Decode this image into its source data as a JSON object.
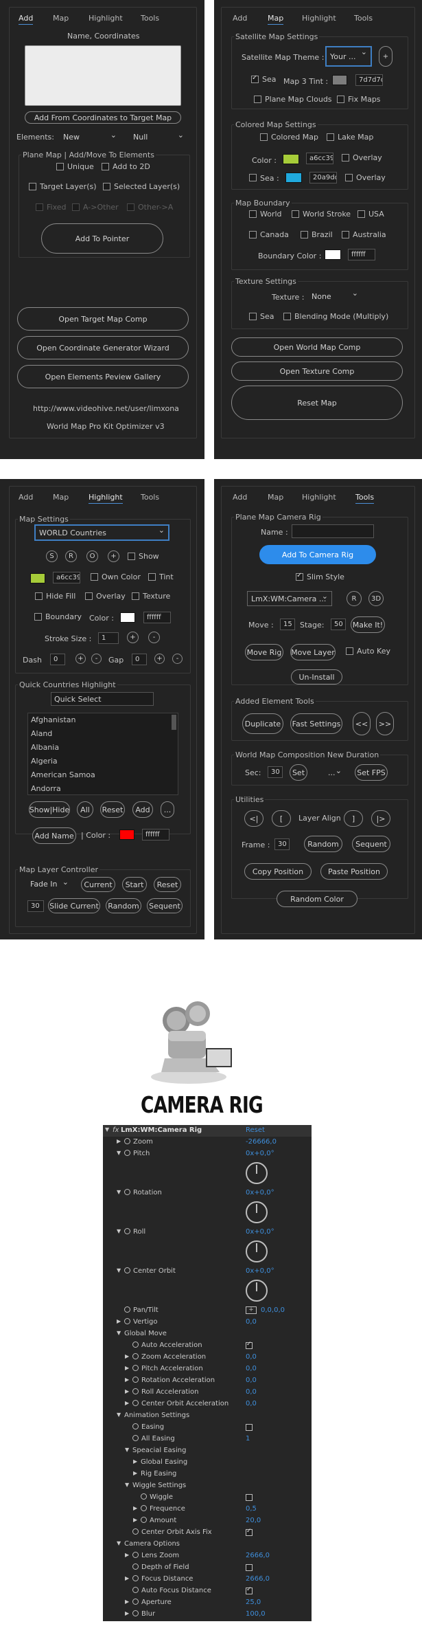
{
  "panel1": {
    "tabs": [
      "Add",
      "Map",
      "Highlight",
      "Tools"
    ],
    "coords_label": "Name, Coordinates",
    "add_from_coords": "Add From Coordinates to Target Map",
    "elements_label": "Elements:",
    "elements_value": "New",
    "elements_value2": "Null",
    "plane_map_group": "Plane Map | Add/Move To Elements",
    "unique": "Unique",
    "add_to_2d": "Add to 2D",
    "target_layers": "Target Layer(s)",
    "selected_layers": "Selected Layer(s)",
    "fixed": "Fixed",
    "a_to_other": "A->Other",
    "other_to_a": "Other->A",
    "add_to_pointer": "Add To Pointer",
    "open_target_map": "Open Target Map Comp",
    "open_coord_gen": "Open Coordinate Generator Wizard",
    "open_elements": "Open Elements Peview Gallery",
    "url": "http://www.videohive.net/user/limxona",
    "version": "World Map Pro Kit Optimizer v3"
  },
  "panel2": {
    "tabs": [
      "Add",
      "Map",
      "Highlight",
      "Tools"
    ],
    "sat_group": "Satellite Map Settings",
    "sat_theme_label": "Satellite Map Theme :",
    "sat_theme_value": "Your ...",
    "plus": "+",
    "sea": "Sea",
    "map3_tint": "Map 3 Tint :",
    "map3_tint_hex": "7d7d7d",
    "plane_map_clouds": "Plane Map Clouds",
    "fix_maps": "Fix Maps",
    "colored_group": "Colored Map Settings",
    "colored_map": "Colored Map",
    "lake_map": "Lake Map",
    "color_label": "Color :",
    "color_hex": "a6cc39",
    "overlay": "Overlay",
    "sea_label": "Sea :",
    "sea_hex": "20a9dd",
    "overlay2": "Overlay",
    "boundary_group": "Map Boundary",
    "world": "World",
    "world_stroke": "World Stroke",
    "usa": "USA",
    "canada": "Canada",
    "brazil": "Brazil",
    "australia": "Australia",
    "boundary_color_label": "Boundary Color :",
    "boundary_hex": "ffffff",
    "texture_group": "Texture Settings",
    "texture_label": "Texture :",
    "texture_value": "None",
    "sea2": "Sea",
    "blending": "Blending Mode (Multiply)",
    "open_world": "Open World Map Comp",
    "open_texture": "Open Texture Comp",
    "reset_map": "Reset Map"
  },
  "panel3": {
    "tabs": [
      "Add",
      "Map",
      "Highlight",
      "Tools"
    ],
    "map_settings": "Map Settings",
    "world_countries": "WORLD Countries",
    "btn_s": "S",
    "btn_r": "R",
    "btn_o": "O",
    "btn_plus": "+",
    "show": "Show",
    "color_hex": "a6cc39",
    "own_color": "Own Color",
    "tint": "Tint",
    "hide_fill": "Hide Fill",
    "overlay": "Overlay",
    "texture": "Texture",
    "boundary": "Boundary",
    "color_label": "Color :",
    "boundary_hex": "ffffff",
    "stroke_size_label": "Stroke Size :",
    "stroke_size": "1",
    "dash_label": "Dash",
    "dash_value": "0",
    "gap_label": "Gap",
    "gap_value": "0",
    "quick_group": "Quick Countries Highlight",
    "quick_select": "Quick Select",
    "countries": [
      "Afghanistan",
      "Aland",
      "Albania",
      "Algeria",
      "American Samoa",
      "Andorra"
    ],
    "show_hide": "Show|Hide",
    "all": "All",
    "reset": "Reset",
    "add": "Add",
    "dots": "...",
    "add_name": "Add Name",
    "color2_label": "| Color :",
    "color2_hex": "ffffff",
    "layer_ctrl": "Map Layer Controller",
    "fade_in": "Fade In",
    "current": "Current",
    "start": "Start",
    "reset2": "Reset",
    "n30": "30",
    "slide_current": "Slide Current",
    "random": "Random",
    "sequent": "Sequent"
  },
  "panel4": {
    "tabs": [
      "Add",
      "Map",
      "Highlight",
      "Tools"
    ],
    "cam_group": "Plane Map Camera Rig",
    "name_label": "Name :",
    "add_cam": "Add To Camera Rig",
    "slim": "Slim Style",
    "cam_dd": "LmX:WM:Camera ...",
    "r": "R",
    "threeD": "3D",
    "move_label": "Move :",
    "move_value": "15",
    "stage_label": "Stage:",
    "stage_value": "50",
    "make_it": "Make It!",
    "move_rig": "Move Rig",
    "move_layer": "Move Layer",
    "auto_key": "Auto Key",
    "uninstall": "Un-Install",
    "added_group": "Added Element Tools",
    "duplicate": "Duplicate",
    "fast_settings": "Fast Settings",
    "prev": "<<",
    "next": ">>",
    "comp_group": "World Map Composition New Duration",
    "sec_label": "Sec:",
    "sec_value": "30",
    "set": "Set",
    "set_dd": "...",
    "set_fps": "Set FPS",
    "util_group": "Utilities",
    "al1": "<|",
    "al2": "[",
    "layer_align": "Layer Align",
    "al3": "]",
    "al4": "|>",
    "frame_label": "Frame :",
    "frame_value": "30",
    "random": "Random",
    "sequent": "Sequent",
    "copy_pos": "Copy Position",
    "paste_pos": "Paste Position",
    "random_color": "Random Color"
  },
  "camera_title": "CAMERA RIG",
  "effects": {
    "header": "LmX:WM:Camera Rig",
    "fx": "fx",
    "reset": "Reset",
    "rows": [
      {
        "name": "Zoom",
        "value": "-26666,0"
      },
      {
        "name": "Pitch",
        "value": "0x+0,0°"
      },
      {
        "name": "Rotation",
        "value": "0x+0,0°"
      },
      {
        "name": "Roll",
        "value": "0x+0,0°"
      },
      {
        "name": "Center Orbit",
        "value": "0x+0,0°"
      },
      {
        "name": "Pan/Tilt",
        "value": "0,0,0,0"
      },
      {
        "name": "Vertigo",
        "value": "0,0"
      },
      {
        "name": "Global Move",
        "value": ""
      },
      {
        "name": "Auto Acceleration",
        "value": ""
      },
      {
        "name": "Zoom Acceleration",
        "value": "0,0"
      },
      {
        "name": "Pitch Acceleration",
        "value": "0,0"
      },
      {
        "name": "Rotation Acceleration",
        "value": "0,0"
      },
      {
        "name": "Roll Acceleration",
        "value": "0,0"
      },
      {
        "name": "Center Orbit Acceleration",
        "value": "0,0"
      },
      {
        "name": "Animation Settings",
        "value": ""
      },
      {
        "name": "Easing",
        "value": ""
      },
      {
        "name": "All Easing",
        "value": "1"
      },
      {
        "name": "Speacial Easing",
        "value": ""
      },
      {
        "name": "Global Easing",
        "value": ""
      },
      {
        "name": "Rig Easing",
        "value": ""
      },
      {
        "name": "Wiggle Settings",
        "value": ""
      },
      {
        "name": "Wiggle",
        "value": ""
      },
      {
        "name": "Frequence",
        "value": "0,5"
      },
      {
        "name": "Amount",
        "value": "20,0"
      },
      {
        "name": "Center Orbit Axis Fix",
        "value": ""
      },
      {
        "name": "Camera Options",
        "value": ""
      },
      {
        "name": "Lens Zoom",
        "value": "2666,0"
      },
      {
        "name": "Depth of Field",
        "value": ""
      },
      {
        "name": "Focus Distance",
        "value": "2666,0"
      },
      {
        "name": "Auto Focus Distance",
        "value": ""
      },
      {
        "name": "Aperture",
        "value": "25,0"
      },
      {
        "name": "Blur",
        "value": "100,0"
      }
    ]
  }
}
